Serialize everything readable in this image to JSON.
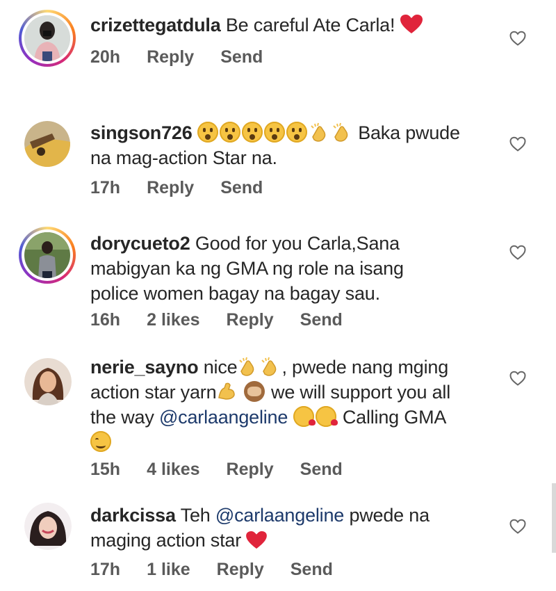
{
  "comments": [
    {
      "username": "crizettegatdula",
      "text": "Be careful Ate Carla!",
      "time": "20h",
      "likes": "",
      "reply_label": "Reply",
      "send_label": "Send",
      "has_story_ring": true
    },
    {
      "username": "singson726",
      "text_after_emoji": "Baka pwude",
      "text_line2": "na mag-action Star na.",
      "time": "17h",
      "likes": "",
      "reply_label": "Reply",
      "send_label": "Send",
      "has_story_ring": false
    },
    {
      "username": "dorycueto2",
      "text_line1": "Good for you Carla,Sana",
      "text_line2": "mabigyan ka ng GMA ng role na isang",
      "text_line3": "police women bagay na bagay sau.",
      "time": "16h",
      "likes": "2 likes",
      "reply_label": "Reply",
      "send_label": "Send",
      "has_story_ring": true
    },
    {
      "username": "nerie_sayno",
      "text_part1": "nice",
      "text_part2": ", pwede nang mging",
      "text_line2a": "action star yarn",
      "text_line2b": "we will support you all",
      "text_line3a": "the way",
      "mention": "@carlaangeline",
      "text_line3b": "Calling GMA",
      "time": "15h",
      "likes": "4 likes",
      "reply_label": "Reply",
      "send_label": "Send",
      "has_story_ring": false
    },
    {
      "username": "darkcissa",
      "text_part1": "Teh",
      "mention": "@carlaangeline",
      "text_part2": "pwede na",
      "text_line2": "maging action star",
      "time": "17h",
      "likes": "1 like",
      "reply_label": "Reply",
      "send_label": "Send",
      "has_story_ring": false
    }
  ],
  "colors": {
    "text": "#262626",
    "meta": "#5a5a5a",
    "mention": "#1d3a6b",
    "heart_red": "#e0243b"
  },
  "icons": [
    "heart-outline-icon",
    "red-heart-emoji",
    "surprised-face-emoji",
    "clapping-hands-emoji",
    "flexed-biceps-emoji",
    "see-no-evil-monkey-emoji",
    "face-blowing-kiss-emoji",
    "smiling-face-emoji"
  ]
}
